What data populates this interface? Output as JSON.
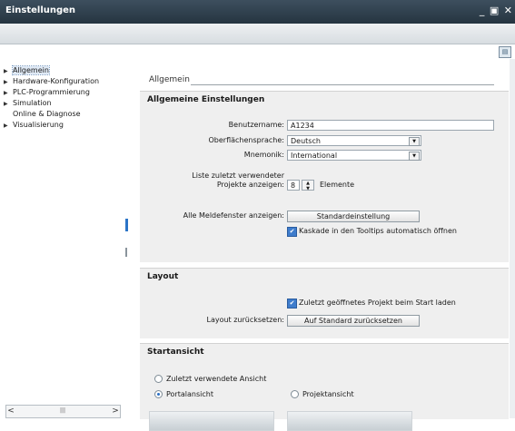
{
  "window": {
    "title": "Einstellungen",
    "controls": "_ ▣ ✕"
  },
  "nav": {
    "items": [
      {
        "label": "Allgemein",
        "arrow": true,
        "selected": true
      },
      {
        "label": "Hardware-Konfiguration",
        "arrow": true
      },
      {
        "label": "PLC-Programmierung",
        "arrow": true
      },
      {
        "label": "Simulation",
        "arrow": true
      },
      {
        "label": "Online & Diagnose",
        "arrow": false
      },
      {
        "label": "Visualisierung",
        "arrow": true
      }
    ],
    "scroll_left": "<",
    "scroll_right": ">",
    "scroll_thumb": "|||"
  },
  "content": {
    "section_title": "Allgemein",
    "general": {
      "heading": "Allgemeine Einstellungen",
      "username_label": "Benutzername:",
      "username_value": "A1234",
      "ui_language_label": "Oberflächensprache:",
      "ui_language_value": "Deutsch",
      "mnemonic_label": "Mnemonik:",
      "mnemonic_value": "International",
      "recent_list_label_1": "Liste zuletzt verwendeter",
      "recent_list_label_2": "Projekte anzeigen:",
      "recent_list_value": "8",
      "recent_list_unit": "Elemente",
      "message_windows_label": "Alle Meldefenster anzeigen:",
      "default_button": "Standardeinstellung",
      "cascade_checkbox": "Kaskade in den Tooltips automatisch öffnen"
    },
    "layout": {
      "heading": "Layout",
      "open_last_project_checkbox": "Zuletzt geöffnetes Projekt beim Start laden",
      "reset_label": "Layout zurücksetzen:",
      "reset_button": "Auf Standard zurücksetzen"
    },
    "start_view": {
      "heading": "Startansicht",
      "option_last_view": "Zuletzt verwendete Ansicht",
      "option_portal": "Portalansicht",
      "option_project": "Projektansicht",
      "selected": "Portalansicht"
    }
  }
}
